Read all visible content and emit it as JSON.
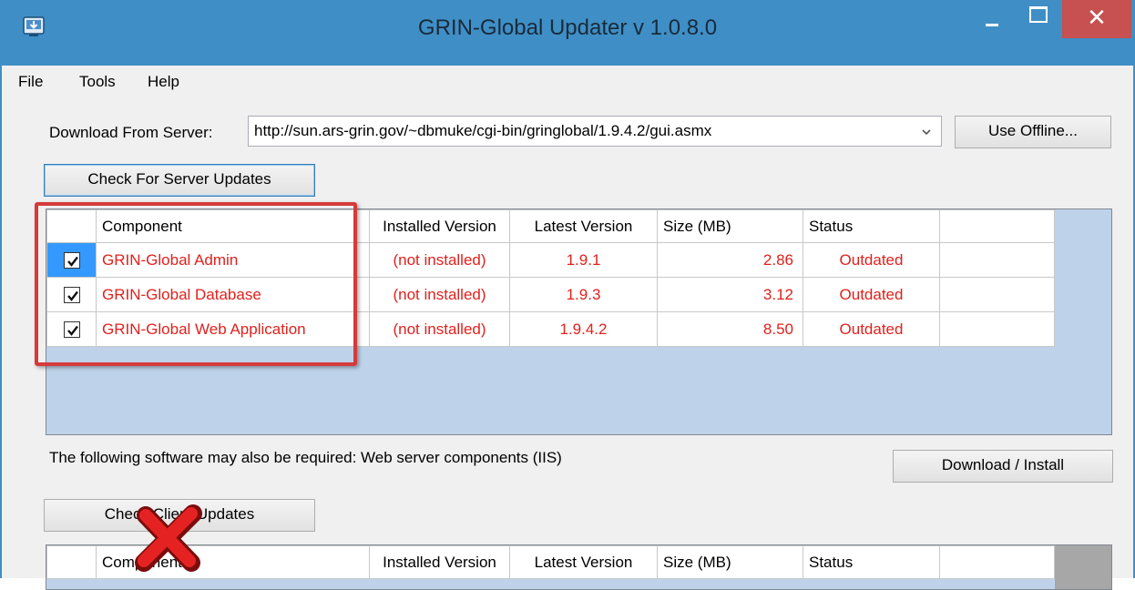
{
  "window": {
    "title": "GRIN-Global Updater v 1.0.8.0",
    "close_glyph": "✕"
  },
  "menu": [
    "File",
    "Tools",
    "Help"
  ],
  "server": {
    "label": "Download From Server:",
    "url": "http://sun.ars-grin.gov/~dbmuke/cgi-bin/gringlobal/1.9.4.2/gui.asmx",
    "offline_button": "Use Offline...",
    "check_button": "Check For Server Updates"
  },
  "server_grid": {
    "columns": [
      "Component",
      "Installed Version",
      "Latest Version",
      "Size (MB)",
      "Status"
    ],
    "rows": [
      {
        "checked": true,
        "component": "GRIN-Global Admin",
        "installed": "(not installed)",
        "latest": "1.9.1",
        "size": "2.86",
        "status": "Outdated"
      },
      {
        "checked": true,
        "component": "GRIN-Global Database",
        "installed": "(not installed)",
        "latest": "1.9.3",
        "size": "3.12",
        "status": "Outdated"
      },
      {
        "checked": true,
        "component": "GRIN-Global Web Application",
        "installed": "(not installed)",
        "latest": "1.9.4.2",
        "size": "8.50",
        "status": "Outdated"
      }
    ]
  },
  "required_note": "The following software may also be required: Web server components (IIS)",
  "download_button": "Download / Install",
  "client": {
    "check_button": "Check Client Updates",
    "columns": [
      "Component",
      "Installed Version",
      "Latest Version",
      "Size (MB)",
      "Status"
    ]
  },
  "colors": {
    "accent": "#3f8fc6",
    "close": "#c75050",
    "outdated_text": "#e0211d",
    "highlight": "#d63a3a",
    "grid_bg": "#bed3ea"
  },
  "icons": [
    "app-updater-icon",
    "minimize-icon",
    "maximize-icon",
    "close-icon",
    "chevron-down-icon",
    "checkmark-icon",
    "red-x-mark-icon"
  ]
}
